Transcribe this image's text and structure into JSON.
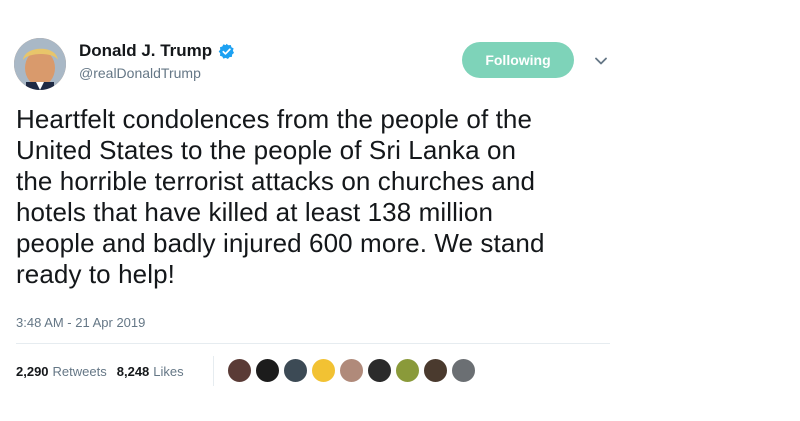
{
  "author": {
    "display_name": "Donald J. Trump",
    "handle": "@realDonaldTrump",
    "verified": true,
    "avatar_icon": "profile-photo"
  },
  "follow_button": {
    "label": "Following",
    "color": "#7ed3b9"
  },
  "menu": {
    "icon": "chevron-down-icon"
  },
  "tweet": {
    "text": "Heartfelt condolences from the people of the\nUnited States to the people of Sri Lanka on\nthe horrible terrorist attacks on churches and\nhotels that have killed at least 138 million\npeople and badly injured 600 more. We stand\nready to help!",
    "timestamp": "3:48 AM - 21 Apr 2019"
  },
  "stats": {
    "retweets_count": "2,290",
    "retweets_label": "Retweets",
    "likes_count": "8,248",
    "likes_label": "Likes"
  },
  "likers": [
    {
      "color": "#5a3b36"
    },
    {
      "color": "#1c1c1c"
    },
    {
      "color": "#3c4a55"
    },
    {
      "color": "#f2c233"
    },
    {
      "color": "#b08a7a"
    },
    {
      "color": "#2b2b2b"
    },
    {
      "color": "#8a9a3a"
    },
    {
      "color": "#4a3a2e"
    },
    {
      "color": "#6b6f73"
    }
  ],
  "colors": {
    "text_primary": "#14171a",
    "text_secondary": "#657786",
    "verified_blue": "#1da1f2",
    "divider": "#e6ecf0"
  }
}
